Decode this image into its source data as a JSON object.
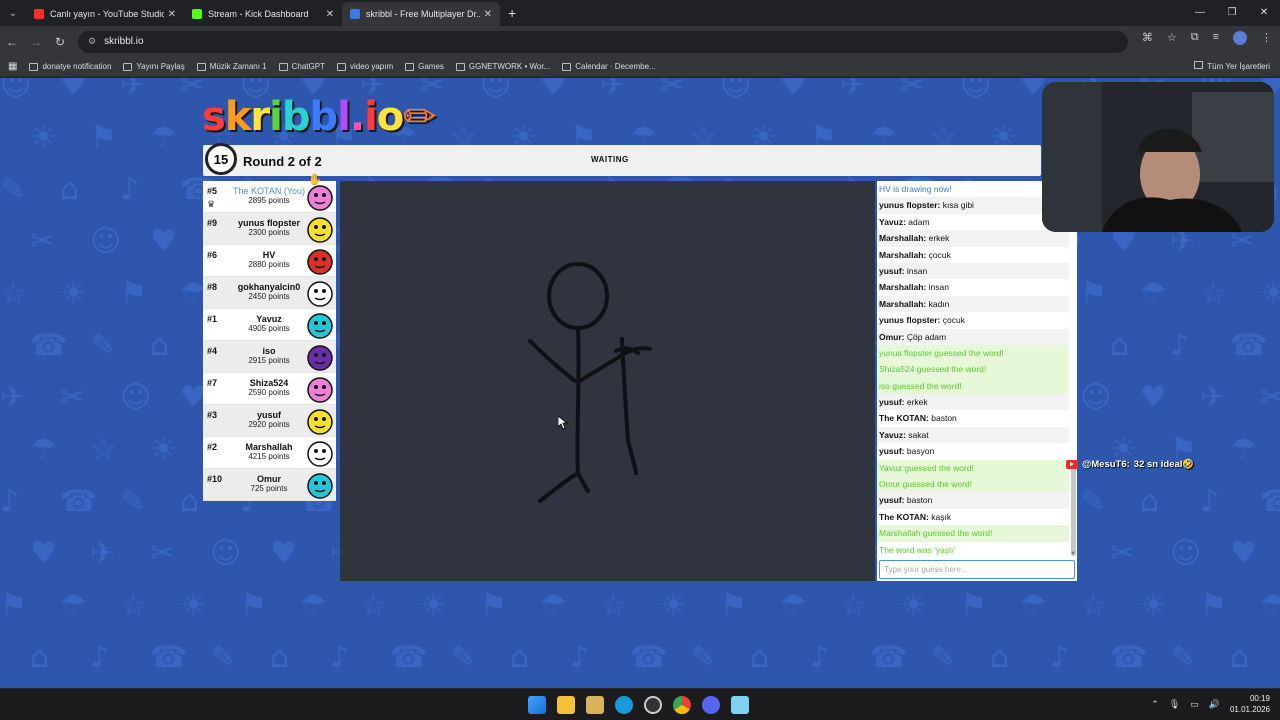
{
  "browser": {
    "tabs": [
      {
        "title": "Canlı yayın - YouTube Studio",
        "color": "#ff2d2d",
        "active": false
      },
      {
        "title": "Stream - Kick Dashboard",
        "color": "#53fc18",
        "active": false
      },
      {
        "title": "skribbl - Free Multiplayer Dr...",
        "color": "#3b7be0",
        "active": true
      }
    ],
    "url": "skribbl.io",
    "bookmarks": [
      "donatye notification",
      "Yayını Paylaş",
      "Müzik Zamanı 1",
      "ChatGPT",
      "video yapım",
      "Games",
      "GGNETWORK • Wor...",
      "Calendar · Decembe..."
    ],
    "bookmarks_all": "Tüm Yer İşaretleri"
  },
  "game": {
    "logo": "skribbl.io",
    "timer": "15",
    "round": "Round 2 of 2",
    "status": "WAITING",
    "players": [
      {
        "rank": "#5",
        "name": "The KOTAN (You)",
        "points": "2895 points",
        "you": true,
        "crown": true,
        "color": "#f07fd6"
      },
      {
        "rank": "#9",
        "name": "yunus flopster",
        "points": "2300 points",
        "color": "#f5e12a"
      },
      {
        "rank": "#6",
        "name": "HV",
        "points": "2880 points",
        "color": "#d9302a"
      },
      {
        "rank": "#8",
        "name": "gokhanyalcin0",
        "points": "2450 points",
        "color": "#ffffff"
      },
      {
        "rank": "#1",
        "name": "Yavuz",
        "points": "4905 points",
        "color": "#27c6d6"
      },
      {
        "rank": "#4",
        "name": "iso",
        "points": "2915 points",
        "color": "#6a2fa8"
      },
      {
        "rank": "#7",
        "name": "Shiza524",
        "points": "2590 points",
        "color": "#f07fd6"
      },
      {
        "rank": "#3",
        "name": "yusuf",
        "points": "2920 points",
        "color": "#f5e12a"
      },
      {
        "rank": "#2",
        "name": "Marshallah",
        "points": "4215 points",
        "color": "#ffffff"
      },
      {
        "rank": "#10",
        "name": "Omur",
        "points": "725 points",
        "color": "#27c6d6"
      }
    ],
    "chat": [
      {
        "user": "",
        "text": "HV is drawing now!",
        "type": "sys-blue"
      },
      {
        "user": "yunus flopster:",
        "text": " kısa gibi",
        "type": "msg"
      },
      {
        "user": "Yavuz:",
        "text": " adam",
        "type": "msg"
      },
      {
        "user": "Marshallah:",
        "text": " erkek",
        "type": "msg"
      },
      {
        "user": "Marshallah:",
        "text": " çocuk",
        "type": "msg"
      },
      {
        "user": "yusuf:",
        "text": " insan",
        "type": "msg"
      },
      {
        "user": "Marshallah:",
        "text": " insan",
        "type": "msg"
      },
      {
        "user": "Marshallah:",
        "text": " kadın",
        "type": "msg"
      },
      {
        "user": "yunus flopster:",
        "text": " çocuk",
        "type": "msg"
      },
      {
        "user": "Omur:",
        "text": " Çöp adam",
        "type": "msg"
      },
      {
        "user": "",
        "text": "yunus flopster guessed the word!",
        "type": "guess"
      },
      {
        "user": "",
        "text": "Shiza524 guessed the word!",
        "type": "guess"
      },
      {
        "user": "",
        "text": "iso guessed the word!",
        "type": "guess"
      },
      {
        "user": "yusuf:",
        "text": " erkek",
        "type": "msg"
      },
      {
        "user": "The KOTAN:",
        "text": " baston",
        "type": "msg"
      },
      {
        "user": "Yavuz:",
        "text": " sakat",
        "type": "msg"
      },
      {
        "user": "yusuf:",
        "text": " basyon",
        "type": "msg"
      },
      {
        "user": "",
        "text": "Yavuz guessed the word!",
        "type": "guess"
      },
      {
        "user": "",
        "text": "Omur guessed the word!",
        "type": "guess"
      },
      {
        "user": "yusuf:",
        "text": " baston",
        "type": "msg"
      },
      {
        "user": "The KOTAN:",
        "text": " kaşık",
        "type": "msg"
      },
      {
        "user": "",
        "text": "Marshallah guessed the word!",
        "type": "guess"
      },
      {
        "user": "",
        "text": "The word was 'yaşlı'",
        "type": "word"
      }
    ],
    "chat_placeholder": "Type your guess here..."
  },
  "overlay": {
    "comment_user": "@MesuT6:",
    "comment_text": "32 sn ideal🤣"
  },
  "taskbar": {
    "time": "00:19",
    "date": "01.01.2026"
  }
}
